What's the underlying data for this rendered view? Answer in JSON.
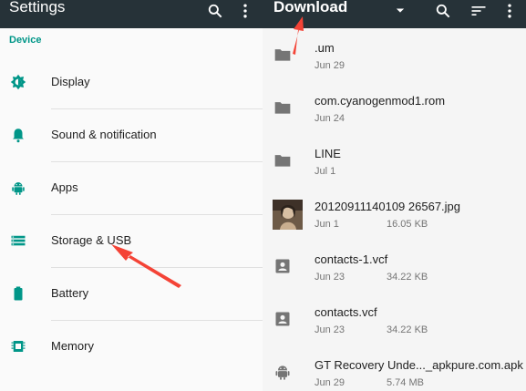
{
  "settings": {
    "title": "Settings",
    "toolbar_icons": [
      "search-icon",
      "more-vert-icon"
    ],
    "section": "Device",
    "items": [
      {
        "label": "Display",
        "icon": "brightness-icon"
      },
      {
        "label": "Sound & notification",
        "icon": "bell-icon"
      },
      {
        "label": "Apps",
        "icon": "android-icon"
      },
      {
        "label": "Storage & USB",
        "icon": "storage-icon"
      },
      {
        "label": "Battery",
        "icon": "battery-icon"
      },
      {
        "label": "Memory",
        "icon": "memory-icon"
      }
    ]
  },
  "files": {
    "title": "Download",
    "toolbar_icons": [
      "dropdown-icon",
      "search-icon",
      "sort-icon",
      "more-vert-icon"
    ],
    "items": [
      {
        "name": ".um",
        "date": "Jun 29",
        "size": "",
        "icon": "folder-icon"
      },
      {
        "name": "com.cyanogenmod1.rom",
        "date": "Jun 24",
        "size": "",
        "icon": "folder-icon"
      },
      {
        "name": "LINE",
        "date": "Jul 1",
        "size": "",
        "icon": "folder-icon"
      },
      {
        "name": "20120911140109 26567.jpg",
        "date": "Jun 1",
        "size": "16.05 KB",
        "icon": "image-thumbnail"
      },
      {
        "name": "contacts-1.vcf",
        "date": "Jun 23",
        "size": "34.22 KB",
        "icon": "contact-icon"
      },
      {
        "name": "contacts.vcf",
        "date": "Jun 23",
        "size": "34.22 KB",
        "icon": "contact-icon"
      },
      {
        "name": "GT Recovery Unde..._apkpure.com.apk",
        "date": "Jun 29",
        "size": "5.74 MB",
        "icon": "android-icon"
      }
    ]
  },
  "colors": {
    "toolbar": "#263238",
    "accent": "#009688",
    "annotation_arrow": "#f44336"
  }
}
